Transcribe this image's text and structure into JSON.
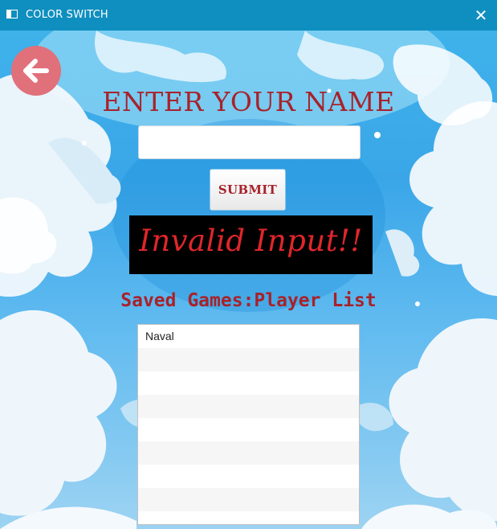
{
  "window": {
    "title": "COLOR SWITCH",
    "close_glyph": "✕"
  },
  "heading": "ENTER YOUR NAME",
  "name_input": {
    "value": "",
    "placeholder": ""
  },
  "submit_label": "SUBMIT",
  "error_message": "Invalid Input!!",
  "saved_games_label": "Saved Games:Player List",
  "player_list": [
    "Naval",
    "",
    "",
    "",
    "",
    "",
    "",
    ""
  ],
  "icons": {
    "back": "arrow-left-icon",
    "app": "window-icon",
    "close": "close-icon"
  },
  "colors": {
    "titlebar": "#0f8fbf",
    "heading": "#a8222a",
    "error": "#e0262a",
    "back_button": "#e0707a"
  }
}
